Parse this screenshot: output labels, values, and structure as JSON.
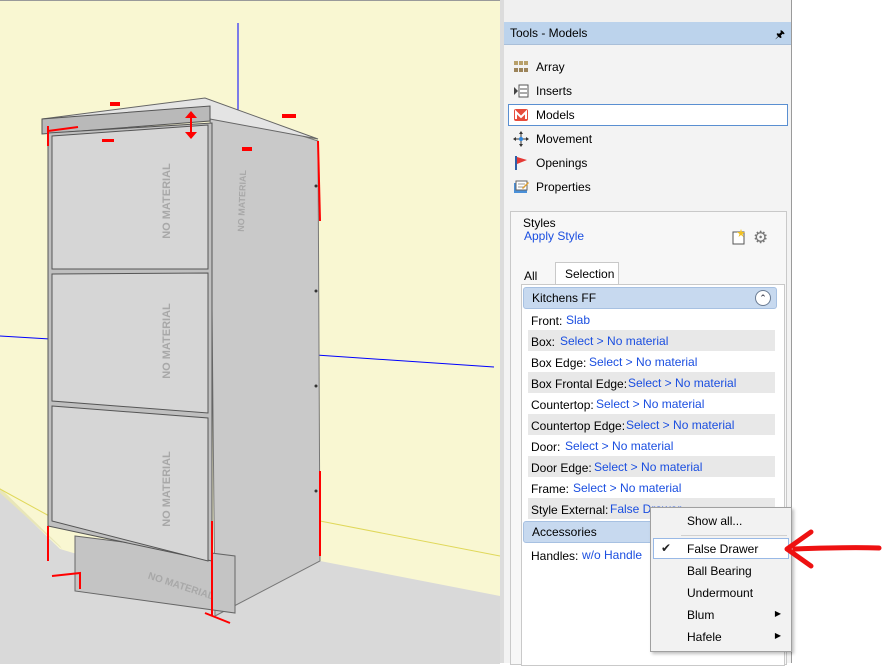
{
  "panel": {
    "title": "Tools - Models",
    "pin_icon": "pin-icon"
  },
  "tools": [
    {
      "label": "Array",
      "icon": "array-icon",
      "selected": false
    },
    {
      "label": "Inserts",
      "icon": "inserts-icon",
      "selected": false
    },
    {
      "label": "Models",
      "icon": "models-icon",
      "selected": true
    },
    {
      "label": "Movement",
      "icon": "movement-icon",
      "selected": false
    },
    {
      "label": "Openings",
      "icon": "openings-icon",
      "selected": false
    },
    {
      "label": "Properties",
      "icon": "properties-icon",
      "selected": false
    }
  ],
  "styles": {
    "legend": "Styles",
    "apply_label": "Apply Style",
    "tabs": [
      "All",
      "Selection"
    ],
    "active_tab": "Selection"
  },
  "group_kitchens": {
    "title": "Kitchens FF",
    "rows": [
      {
        "key": "Front:",
        "value": "Slab"
      },
      {
        "key": "Box:",
        "value": "Select > No material"
      },
      {
        "key": "Box Edge:",
        "value": "Select > No material"
      },
      {
        "key": "Box Frontal Edge:",
        "value": "Select > No material"
      },
      {
        "key": "Countertop:",
        "value": "Select > No material"
      },
      {
        "key": "Countertop Edge:",
        "value": "Select > No material"
      },
      {
        "key": "Door:",
        "value": "Select > No material"
      },
      {
        "key": "Door Edge:",
        "value": "Select > No material"
      },
      {
        "key": "Frame:",
        "value": "Select > No material"
      },
      {
        "key": "Style External:",
        "value": "False Drawer"
      }
    ]
  },
  "group_accessories": {
    "title": "Accessories",
    "rows": [
      {
        "key": "Handles:",
        "value": "w/o Handle"
      }
    ]
  },
  "context_menu": {
    "items": [
      {
        "label": "Show all...",
        "checked": false,
        "submenu": false
      },
      {
        "label": "False Drawer",
        "checked": true,
        "submenu": false
      },
      {
        "label": "Ball Bearing",
        "checked": false,
        "submenu": false
      },
      {
        "label": "Undermount",
        "checked": false,
        "submenu": false
      },
      {
        "label": "Blum",
        "checked": false,
        "submenu": true
      },
      {
        "label": "Hafele",
        "checked": false,
        "submenu": true
      }
    ]
  },
  "viewport": {
    "material_label": "NO MATERIAL",
    "colors": {
      "background": "#f9f7d2",
      "floor": "#d9d9d9",
      "cabinet": "#c8c8c8",
      "selection": "#ff0000",
      "axis": "#0000ff"
    }
  },
  "colors": {
    "link": "#1a4ee0",
    "header": "#bcd3ec",
    "group": "#c7d9ef",
    "annotation_arrow": "#ff0000"
  }
}
